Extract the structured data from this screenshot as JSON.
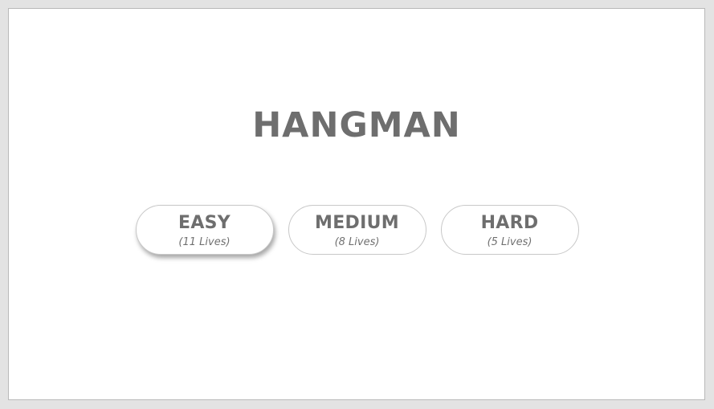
{
  "game": {
    "title": "HANGMAN"
  },
  "difficulties": [
    {
      "label": "EASY",
      "lives": "(11 Lives)",
      "selected": true
    },
    {
      "label": "MEDIUM",
      "lives": "(8 Lives)",
      "selected": false
    },
    {
      "label": "HARD",
      "lives": "(5 Lives)",
      "selected": false
    }
  ],
  "colors": {
    "text": "#6e6e6e",
    "background": "#ffffff",
    "outer_background": "#e3e3e3",
    "button_border": "#c8c8c8"
  }
}
